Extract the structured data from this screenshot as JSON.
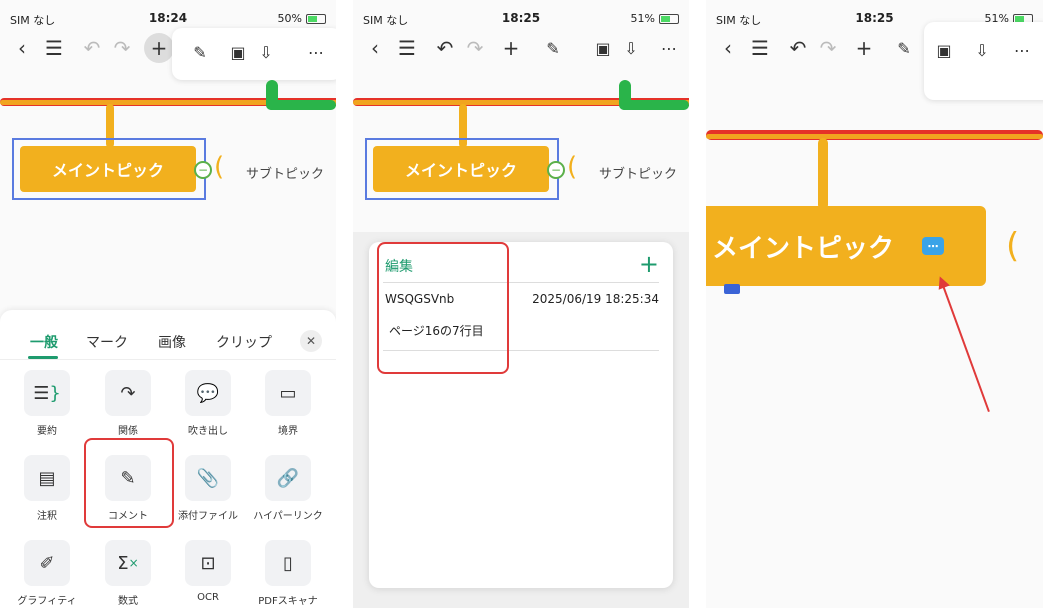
{
  "status": {
    "carrier": "SIM なし",
    "panel1": {
      "time": "18:24",
      "battery": "50%"
    },
    "panel2": {
      "time": "18:25",
      "battery": "51%"
    },
    "panel3": {
      "time": "18:25",
      "battery": "51%"
    }
  },
  "mindmap": {
    "main_topic": "メイントピック",
    "sub_topic": "サブトピック"
  },
  "sheet": {
    "tabs": [
      "一般",
      "マーク",
      "画像",
      "クリップ"
    ],
    "items": [
      {
        "label": "要約",
        "icon": "summary-icon"
      },
      {
        "label": "関係",
        "icon": "relation-icon"
      },
      {
        "label": "吹き出し",
        "icon": "callout-icon"
      },
      {
        "label": "境界",
        "icon": "boundary-icon"
      },
      {
        "label": "注釈",
        "icon": "note-icon"
      },
      {
        "label": "コメント",
        "icon": "comment-icon"
      },
      {
        "label": "添付ファイル",
        "icon": "attachment-icon"
      },
      {
        "label": "ハイパーリンク",
        "icon": "hyperlink-icon"
      },
      {
        "label": "グラフィティ",
        "icon": "graffiti-icon"
      },
      {
        "label": "数式",
        "icon": "formula-icon"
      },
      {
        "label": "OCR",
        "icon": "ocr-icon"
      },
      {
        "label": "PDFスキャナ",
        "icon": "pdf-scanner-icon"
      }
    ]
  },
  "comment_card": {
    "edit_label": "編集",
    "user": "WSQGSVnb",
    "date": "2025/06/19 18:25:34",
    "text": "ページ16の7行目"
  },
  "colors": {
    "accent": "#1e9b6e",
    "topic": "#f2b01e",
    "highlight": "#e03a3a",
    "select": "#5a7be0"
  }
}
